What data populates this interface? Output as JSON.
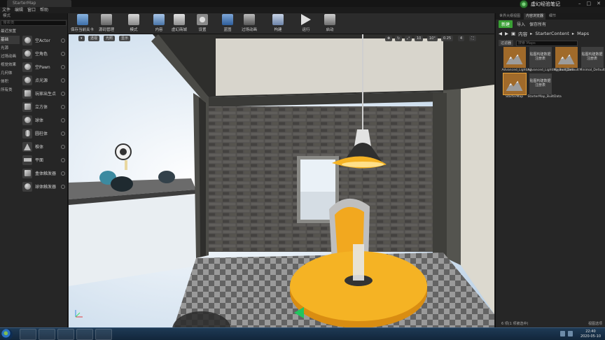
{
  "app": {
    "doc_tab": "StarterMap",
    "brand": "虚幻经验笔记"
  },
  "menu": [
    "文件",
    "编辑",
    "窗口",
    "帮助"
  ],
  "modes": {
    "tab": "模式",
    "search_placeholder": "搜索类",
    "categories": [
      "最近放置",
      "基础",
      "光源",
      "过场动画",
      "视觉效果",
      "几何体",
      "体积",
      "所有类"
    ],
    "items": [
      "空Actor",
      "空角色",
      "空Pawn",
      "点光源",
      "玩家出生点",
      "立方体",
      "球体",
      "圆柱体",
      "椎体",
      "平面",
      "盒体触发器",
      "球体触发器"
    ]
  },
  "toolbar": {
    "buttons": [
      "保存当前关卡",
      "源码管理",
      "模式",
      "内容",
      "虚幻商城",
      "设置",
      "蓝图",
      "过场动画",
      "构建",
      "运行",
      "启动"
    ]
  },
  "viewport": {
    "perspective": "透视",
    "lit": "光照",
    "show": "显示",
    "grid": "10",
    "angle": "10°",
    "scale": "0.25",
    "cam": "4"
  },
  "content": {
    "tabs": [
      "世界大纲视图",
      "内容浏览器",
      "细节"
    ],
    "new_label": "新建",
    "import_label": "导入",
    "save_all_label": "保存所有",
    "path": [
      "内容",
      "StarterContent",
      "Maps"
    ],
    "filter_label": "过滤器",
    "search_placeholder": "搜索 Maps",
    "assets": [
      {
        "name": "Advanced_Lighting",
        "kind": "map"
      },
      {
        "name": "Advanced_Lighting_BuiltData",
        "kind": "data",
        "caption": "贴图构建数据注册表"
      },
      {
        "name": "Minimal_Default",
        "kind": "map"
      },
      {
        "name": "Minimal_Default_BuiltData",
        "kind": "data",
        "caption": "贴图构建数据注册表"
      },
      {
        "name": "StarterMap",
        "kind": "map"
      },
      {
        "name": "StarterMap_BuiltData",
        "kind": "data",
        "caption": "贴图构建数据注册表"
      }
    ],
    "footer_count": "6 项(1 项被选中)",
    "footer_view": "视图选项"
  },
  "taskbar": {
    "time": "22:40",
    "date": "2020-05-10"
  },
  "colors": {
    "accent_green": "#39a034",
    "lamp_yellow": "#f5b324",
    "selection": "#e8a33a"
  }
}
